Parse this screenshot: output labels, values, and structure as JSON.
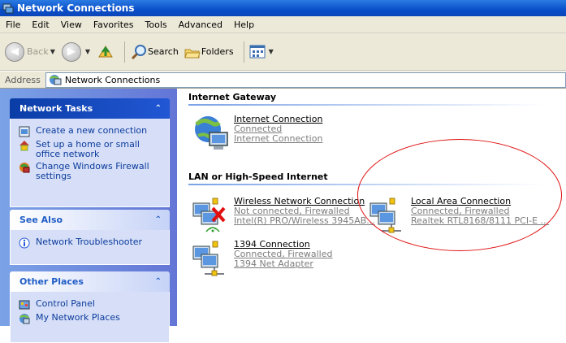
{
  "window": {
    "title": "Network Connections"
  },
  "menu": [
    "File",
    "Edit",
    "View",
    "Favorites",
    "Tools",
    "Advanced",
    "Help"
  ],
  "toolbar": {
    "back": "Back",
    "search": "Search",
    "folders": "Folders"
  },
  "address": {
    "label": "Address",
    "value": "Network Connections"
  },
  "panels": {
    "tasks": {
      "title": "Network Tasks",
      "items": [
        "Create a new connection",
        "Set up a home or small office network",
        "Change Windows Firewall settings"
      ]
    },
    "see_also": {
      "title": "See Also",
      "items": [
        "Network Troubleshooter"
      ]
    },
    "other_places": {
      "title": "Other Places",
      "items": [
        "Control Panel",
        "My Network Places"
      ]
    }
  },
  "groups": {
    "gateway": {
      "title": "Internet Gateway",
      "items": [
        {
          "name": "Internet Connection",
          "status": "Connected",
          "device": "Internet Connection"
        }
      ]
    },
    "lan": {
      "title": "LAN or High-Speed Internet",
      "items": [
        {
          "name": "Wireless Network Connection",
          "status": "Not connected, Firewalled",
          "device": "Intel(R) PRO/Wireless 3945AB..."
        },
        {
          "name": "Local Area Connection",
          "status": "Connected, Firewalled",
          "device": "Realtek RTL8168/8111 PCI-E ..."
        },
        {
          "name": "1394 Connection",
          "status": "Connected, Firewalled",
          "device": "1394 Net Adapter"
        }
      ]
    }
  },
  "colors": {
    "annotation": "#e01010",
    "link": "#0c3b9c",
    "titlebar": "#0a4fc9"
  }
}
